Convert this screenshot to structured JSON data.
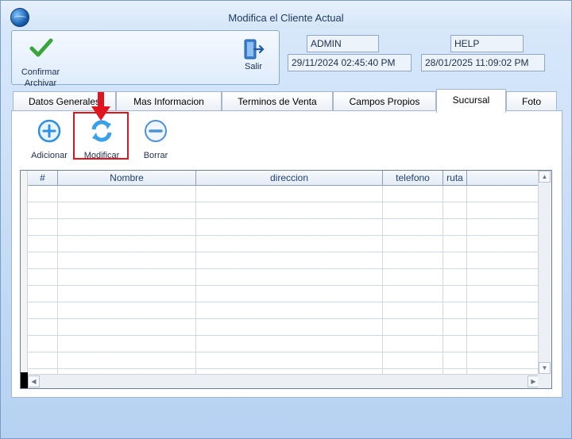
{
  "window": {
    "title": "Modifica el Cliente Actual"
  },
  "actions": {
    "confirm_line1": "Confirmar",
    "confirm_line2": "Archivar",
    "exit_label": "Salir"
  },
  "info": {
    "user": "ADMIN",
    "help": "HELP",
    "date1": "29/11/2024 02:45:40 PM",
    "date2": "28/01/2025 11:09:02 PM"
  },
  "tabs": [
    {
      "label": "Datos Generales"
    },
    {
      "label": "Mas Informacion"
    },
    {
      "label": "Terminos de Venta"
    },
    {
      "label": "Campos Propios"
    },
    {
      "label": "Sucursal"
    },
    {
      "label": "Foto"
    }
  ],
  "toolbar": {
    "add_label": "Adicionar",
    "modify_label": "Modificar",
    "delete_label": "Borrar"
  },
  "grid": {
    "columns": [
      "#",
      "Nombre",
      "direccion",
      "telefono",
      "ruta"
    ]
  },
  "colors": {
    "accent": "#1f3f75",
    "highlight": "#e0141e",
    "check": "#3aa53a"
  }
}
